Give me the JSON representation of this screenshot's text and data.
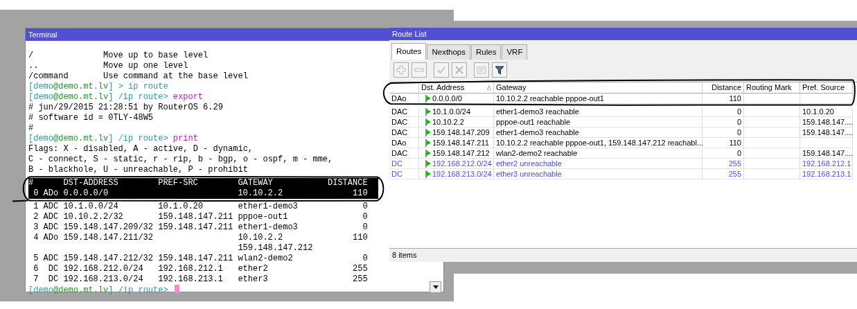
{
  "terminal": {
    "title": "Terminal",
    "lines": [
      {
        "kind": "help",
        "command": "/",
        "description": "Move up to base level"
      },
      {
        "kind": "help",
        "command": "..",
        "description": "Move up one level"
      },
      {
        "kind": "help",
        "command": "/command",
        "description": "Use command at the base level"
      },
      {
        "kind": "prompt",
        "segments": [
          {
            "text": "[demo",
            "kind": "user"
          },
          {
            "text": "@demo.mt.lv",
            "kind": "host"
          },
          {
            "text": "] > ",
            "kind": "path"
          },
          {
            "text": "ip route",
            "kind": "path"
          }
        ]
      },
      {
        "kind": "prompt",
        "segments": [
          {
            "text": "[demo",
            "kind": "user"
          },
          {
            "text": "@demo.mt.lv",
            "kind": "host"
          },
          {
            "text": "] /ip route> ",
            "kind": "path"
          },
          {
            "text": "export",
            "kind": "command"
          }
        ]
      },
      {
        "kind": "text",
        "text": "# jun/29/2015 21:28:51 by RouterOS 6.29"
      },
      {
        "kind": "text",
        "text": "# software id = 0TLY-48W5"
      },
      {
        "kind": "text",
        "text": "#"
      },
      {
        "kind": "prompt",
        "segments": [
          {
            "text": "[demo",
            "kind": "user"
          },
          {
            "text": "@demo.mt.lv",
            "kind": "host"
          },
          {
            "text": "] /ip route> ",
            "kind": "path"
          },
          {
            "text": "print",
            "kind": "command"
          }
        ]
      },
      {
        "kind": "text",
        "text": "Flags: X - disabled, A - active, D - dynamic,"
      },
      {
        "kind": "text",
        "text": "C - connect, S - static, r - rip, b - bgp, o - ospf, m - mme,"
      },
      {
        "kind": "text",
        "text": "B - blackhole, U - unreachable, P - prohibit"
      }
    ],
    "table": {
      "columns": [
        "#",
        "DST-ADDRESS",
        "PREF-SRC",
        "GATEWAY",
        "DISTANCE"
      ],
      "rows": [
        {
          "num": "0",
          "flags": "ADo",
          "dst": "0.0.0.0/0",
          "pref_src": "",
          "gateway": [
            "10.10.2.2"
          ],
          "distance": "110",
          "highlighted": true
        },
        {
          "num": "1",
          "flags": "ADC",
          "dst": "10.1.0.0/24",
          "pref_src": "10.1.0.20",
          "gateway": [
            "ether1-demo3"
          ],
          "distance": "0",
          "highlighted": false
        },
        {
          "num": "2",
          "flags": "ADC",
          "dst": "10.10.2.2/32",
          "pref_src": "159.148.147.211",
          "gateway": [
            "pppoe-out1"
          ],
          "distance": "0",
          "highlighted": false
        },
        {
          "num": "3",
          "flags": "ADC",
          "dst": "159.148.147.209/32",
          "pref_src": "159.148.147.211",
          "gateway": [
            "ether1-demo3"
          ],
          "distance": "0",
          "highlighted": false
        },
        {
          "num": "4",
          "flags": "ADo",
          "dst": "159.148.147.211/32",
          "pref_src": "",
          "gateway": [
            "10.10.2.2",
            "159.148.147.212"
          ],
          "distance": "110",
          "highlighted": false
        },
        {
          "num": "5",
          "flags": "ADC",
          "dst": "159.148.147.212/32",
          "pref_src": "159.148.147.211",
          "gateway": [
            "wlan2-demo2"
          ],
          "distance": "0",
          "highlighted": false
        },
        {
          "num": "6",
          "flags": "DC",
          "dst": "192.168.212.0/24",
          "pref_src": "192.168.212.1",
          "gateway": [
            "ether2"
          ],
          "distance": "255",
          "highlighted": false
        },
        {
          "num": "7",
          "flags": "DC",
          "dst": "192.168.213.0/24",
          "pref_src": "192.168.213.1",
          "gateway": [
            "ether3"
          ],
          "distance": "255",
          "highlighted": false
        }
      ]
    },
    "final_prompt": {
      "segments": [
        {
          "text": "[demo",
          "kind": "user"
        },
        {
          "text": "@demo.mt.lv",
          "kind": "host"
        },
        {
          "text": "] /ip route> ",
          "kind": "path"
        }
      ]
    }
  },
  "route_list": {
    "title": "Route List",
    "tabs": [
      {
        "label": "Routes",
        "selected": true
      },
      {
        "label": "Nexthops",
        "selected": false
      },
      {
        "label": "Rules",
        "selected": false
      },
      {
        "label": "VRF",
        "selected": false
      }
    ],
    "toolbar": [
      {
        "kind": "plus",
        "disabled": true
      },
      {
        "kind": "minus",
        "disabled": true
      },
      {
        "kind": "check",
        "disabled": true
      },
      {
        "kind": "cross",
        "disabled": true
      },
      {
        "kind": "note",
        "disabled": true
      },
      {
        "kind": "filter",
        "disabled": false
      }
    ],
    "columns": [
      "Dst. Address",
      "Gateway",
      "Distance",
      "Routing Mark",
      "Pref. Source"
    ],
    "rows": [
      {
        "flags": "DAo",
        "dst": "0.0.0.0/0",
        "gateway": "10.10.2.2 reachable pppoe-out1",
        "distance": "110",
        "pref_src": "",
        "active": true
      },
      {
        "flags": "DAC",
        "dst": "10.1.0.0/24",
        "gateway": "ether1-demo3 reachable",
        "distance": "0",
        "pref_src": "10.1.0.20",
        "active": true
      },
      {
        "flags": "DAC",
        "dst": "10.10.2.2",
        "gateway": "pppoe-out1 reachable",
        "distance": "0",
        "pref_src": "159.148.147....",
        "active": true
      },
      {
        "flags": "DAC",
        "dst": "159.148.147.209",
        "gateway": "ether1-demo3 reachable",
        "distance": "0",
        "pref_src": "159.148.147....",
        "active": true
      },
      {
        "flags": "DAo",
        "dst": "159.148.147.211",
        "gateway": "10.10.2.2 reachable pppoe-out1, 159.148.147.212 reachabl...",
        "distance": "110",
        "pref_src": "",
        "active": true
      },
      {
        "flags": "DAC",
        "dst": "159.148.147.212",
        "gateway": "wlan2-demo2 reachable",
        "distance": "0",
        "pref_src": "159.148.147....",
        "active": true
      },
      {
        "flags": "DC",
        "dst": "192.168.212.0/24",
        "gateway": "ether2 unreachable",
        "distance": "255",
        "pref_src": "192.168.212.1",
        "active": false
      },
      {
        "flags": "DC",
        "dst": "192.168.213.0/24",
        "gateway": "ether3 unreachable",
        "distance": "255",
        "pref_src": "192.168.213.1",
        "active": false
      }
    ],
    "status": "8 items"
  }
}
